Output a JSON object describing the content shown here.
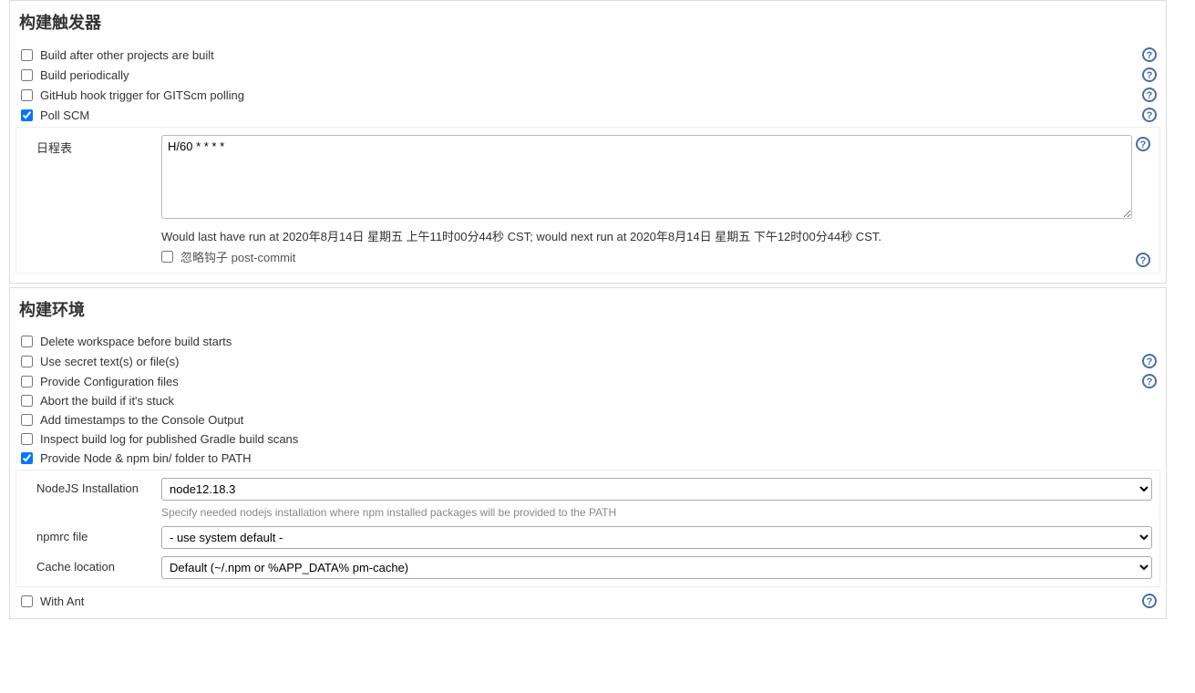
{
  "triggers": {
    "title": "构建触发器",
    "items": [
      {
        "label": "Build after other projects are built",
        "checked": false,
        "help": true
      },
      {
        "label": "Build periodically",
        "checked": false,
        "help": true
      },
      {
        "label": "GitHub hook trigger for GITScm polling",
        "checked": false,
        "help": true
      },
      {
        "label": "Poll SCM",
        "checked": true,
        "help": true
      }
    ],
    "schedule": {
      "label": "日程表",
      "value": "H/60 * * * *",
      "hint": "Would last have run at 2020年8月14日 星期五 上午11时00分44秒 CST; would next run at 2020年8月14日 星期五 下午12时00分44秒 CST.",
      "ignore_hooks_label": "忽略钩子 post-commit"
    }
  },
  "env": {
    "title": "构建环境",
    "items": [
      {
        "label": "Delete workspace before build starts",
        "checked": false,
        "help": false
      },
      {
        "label": "Use secret text(s) or file(s)",
        "checked": false,
        "help": true
      },
      {
        "label": "Provide Configuration files",
        "checked": false,
        "help": true
      },
      {
        "label": "Abort the build if it's stuck",
        "checked": false,
        "help": false
      },
      {
        "label": "Add timestamps to the Console Output",
        "checked": false,
        "help": false
      },
      {
        "label": "Inspect build log for published Gradle build scans",
        "checked": false,
        "help": false
      },
      {
        "label": "Provide Node & npm bin/ folder to PATH",
        "checked": true,
        "help": false
      }
    ],
    "nodejs": {
      "install_label": "NodeJS Installation",
      "install_value": "node12.18.3",
      "install_hint": "Specify needed nodejs installation where npm installed packages will be provided to the PATH",
      "npmrc_label": "npmrc file",
      "npmrc_value": "- use system default -",
      "cache_label": "Cache location",
      "cache_value": "Default (~/.npm or %APP_DATA% pm-cache)"
    },
    "with_ant_label": "With Ant"
  }
}
